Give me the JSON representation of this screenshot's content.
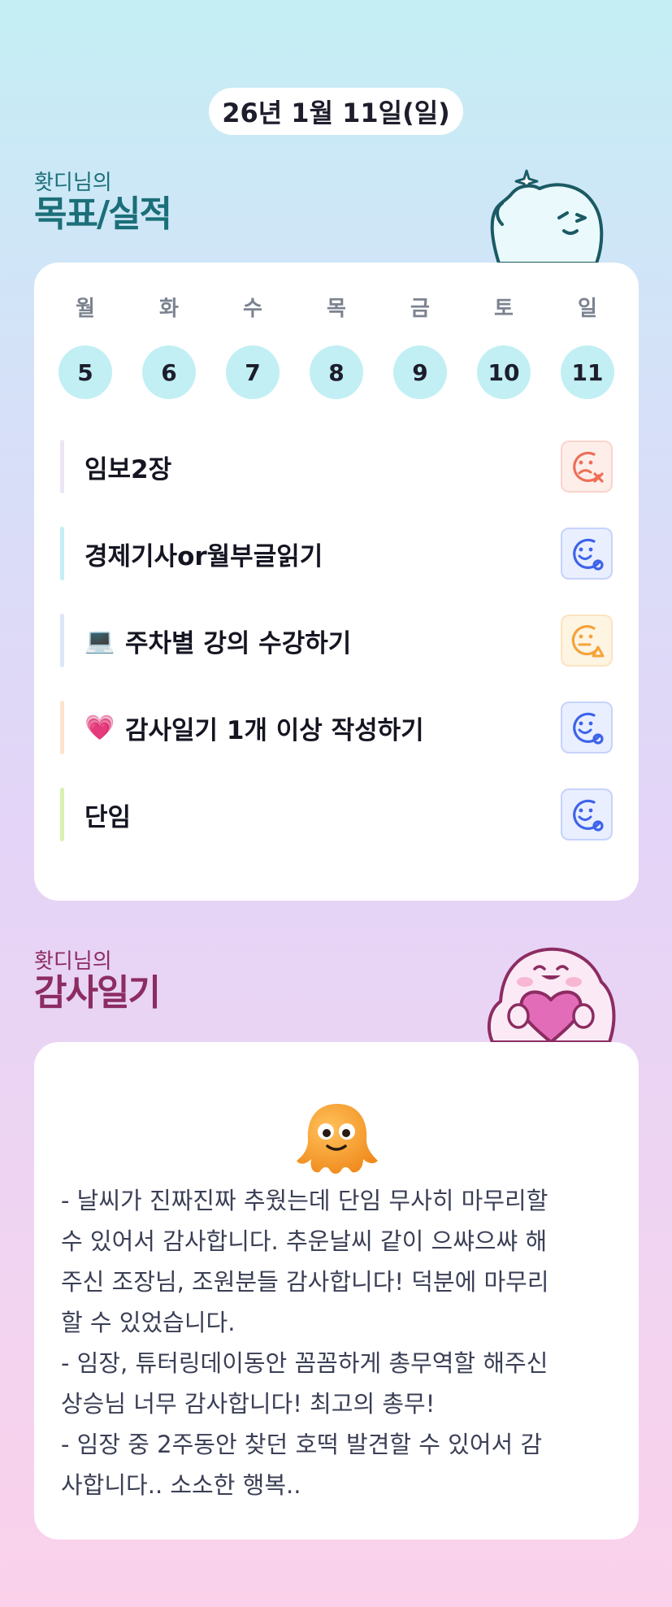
{
  "date": "26년 1월 11일(일)",
  "goals_section": {
    "owner": "홧디님의",
    "title": "목표/실적"
  },
  "week": [
    {
      "weekday": "월",
      "day": "5"
    },
    {
      "weekday": "화",
      "day": "6"
    },
    {
      "weekday": "수",
      "day": "7"
    },
    {
      "weekday": "목",
      "day": "8"
    },
    {
      "weekday": "금",
      "day": "9"
    },
    {
      "weekday": "토",
      "day": "10"
    },
    {
      "weekday": "일",
      "day": "11"
    }
  ],
  "goals": [
    {
      "emoji": "",
      "label": "임보2장",
      "status": "failed",
      "status_icon": "sad-face-x-icon",
      "bar_color": "#ece6f3",
      "status_color": "#ee6f56",
      "status_bg": "#fdeeea"
    },
    {
      "emoji": "",
      "label": "경제기사or월부글읽기",
      "status": "done",
      "status_icon": "smile-face-check-icon",
      "bar_color": "#c4eef4",
      "status_color": "#3d63ea",
      "status_bg": "#e9efff"
    },
    {
      "emoji": "💻",
      "label": "주차별 강의 수강하기",
      "status": "partial",
      "status_icon": "neutral-face-triangle-icon",
      "bar_color": "#dde6f6",
      "status_color": "#f4a33b",
      "status_bg": "#fef4e2"
    },
    {
      "emoji": "💗",
      "label": "감사일기 1개 이상 작성하기",
      "status": "done",
      "status_icon": "smile-face-check-icon",
      "bar_color": "#fde3cc",
      "status_color": "#3d63ea",
      "status_bg": "#e9efff"
    },
    {
      "emoji": "",
      "label": "단임",
      "status": "done",
      "status_icon": "smile-face-check-icon",
      "bar_color": "#d9f0b3",
      "status_color": "#3d63ea",
      "status_bg": "#e9efff"
    }
  ],
  "diary_section": {
    "owner": "홧디님의",
    "title": "감사일기"
  },
  "diary_text": "- 날씨가 진짜진짜 추웠는데 단임 무사히 마무리할\n수 있어서 감사합니다. 추운날씨 같이 으쌰으쌰 해\n주신 조장님, 조원분들 감사합니다! 덕분에 마무리\n할 수 있었습니다.\n- 임장, 튜터링데이동안 꼼꼼하게 총무역할 해주신\n상승님 너무 감사합니다! 최고의 총무!\n- 임장 중 2주동안 찾던 호떡 발견할 수 있어서 감\n사합니다.. 소소한 행복..",
  "colors": {
    "goals_title": "#1b6f78",
    "diary_title": "#8c2c62",
    "day_circle": "#c1eff4"
  }
}
